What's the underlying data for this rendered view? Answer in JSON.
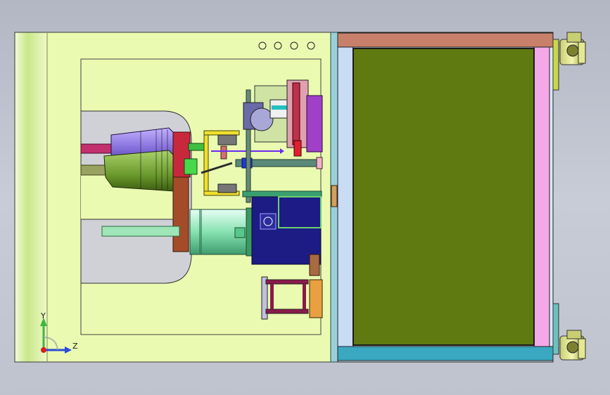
{
  "viewport": {
    "background_top": "#b3b7c4",
    "background_bottom": "#bfc3ce"
  },
  "triad": {
    "y_axis_label": "Y",
    "z_axis_label": "Z",
    "y_color": "#3cb83c",
    "z_color": "#2a4ad8",
    "origin_color": "#d02020"
  },
  "model": {
    "base_plate_color": "#eafab0",
    "cabinet_panel_color": "#5f7a10",
    "mount_hole_count": 4
  }
}
